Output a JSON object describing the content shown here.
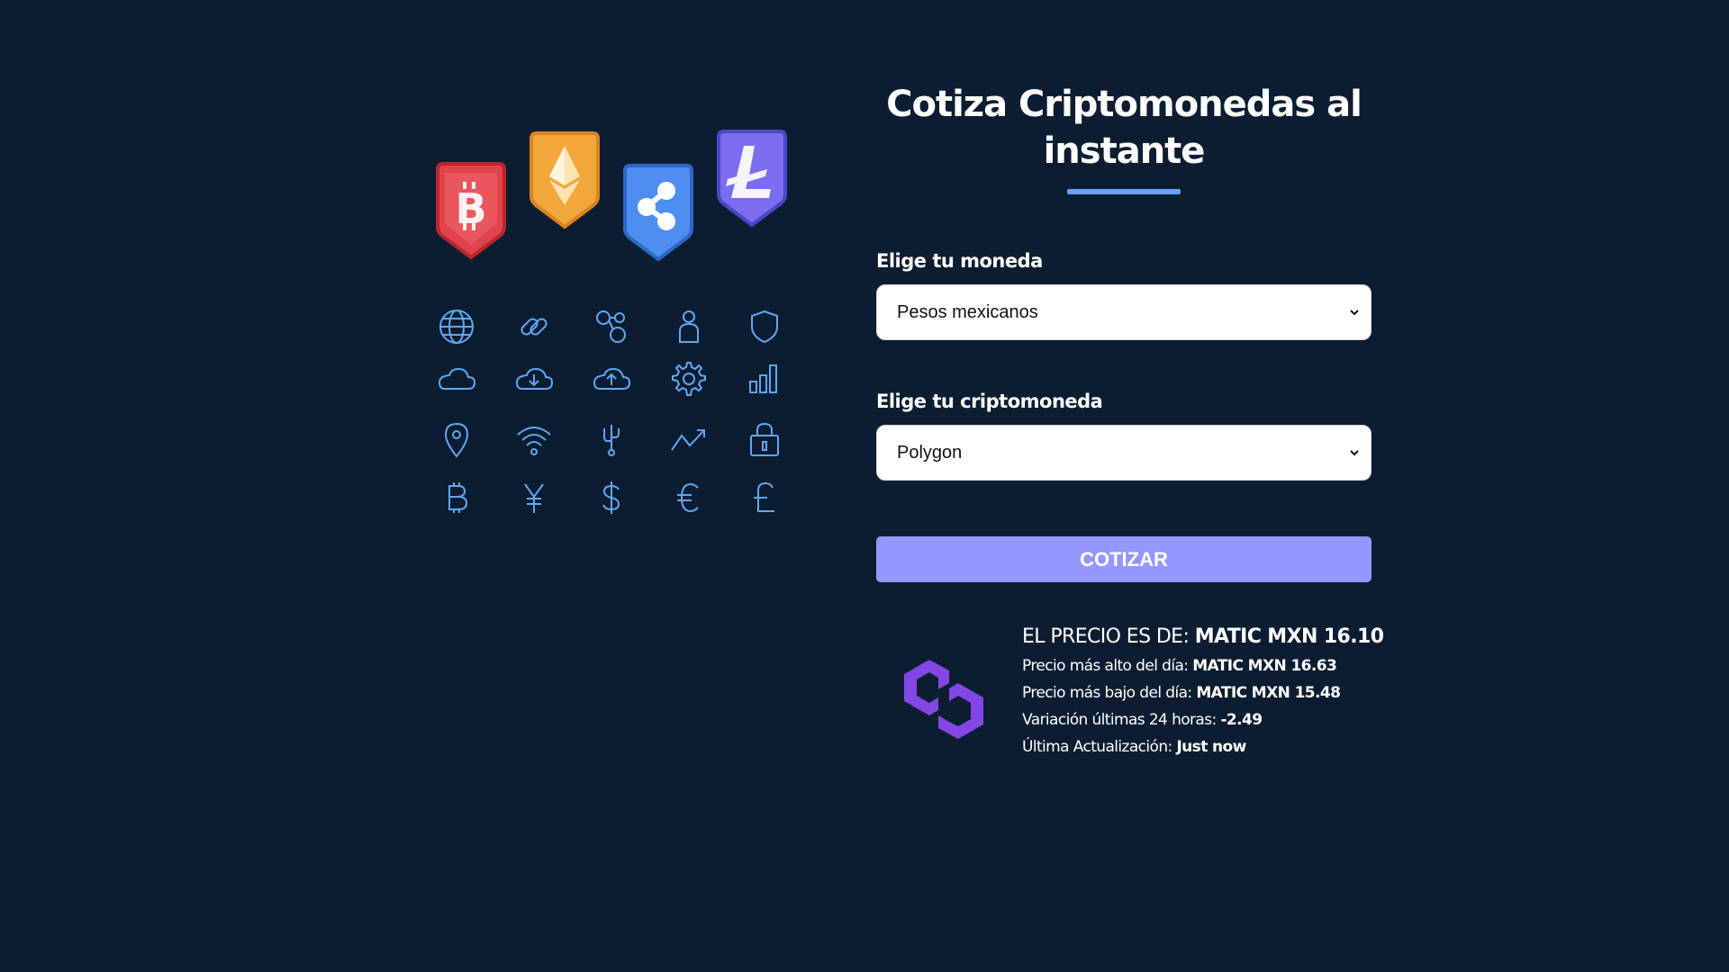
{
  "header": {
    "title": "Cotiza Criptomonedas al instante"
  },
  "form": {
    "currency": {
      "label": "Elige tu moneda",
      "selected": "Pesos mexicanos"
    },
    "crypto": {
      "label": "Elige tu criptomoneda",
      "selected": "Polygon"
    },
    "submit_label": "COTIZAR"
  },
  "result": {
    "price_label": "EL PRECIO ES DE:",
    "price_value": "MATIC MXN 16.10",
    "high_label": "Precio más alto del día:",
    "high_value": "MATIC MXN 16.63",
    "low_label": "Precio más bajo del día:",
    "low_value": "MATIC MXN 15.48",
    "change_label": "Variación últimas 24 horas:",
    "change_value": "-2.49",
    "updated_label": "Última Actualización:",
    "updated_value": "Just now",
    "coin_icon": "polygon-logo-icon"
  },
  "illustration": {
    "badges": [
      "bitcoin-badge-icon",
      "ethereum-badge-icon",
      "ripple-badge-icon",
      "litecoin-badge-icon"
    ],
    "icons": [
      "globe-icon",
      "link-icon",
      "network-icon",
      "user-icon",
      "shield-icon",
      "cloud-icon",
      "cloud-download-icon",
      "cloud-upload-icon",
      "gear-icon",
      "bar-chart-icon",
      "location-pin-icon",
      "wifi-icon",
      "usb-icon",
      "trend-up-icon",
      "lock-icon",
      "bitcoin-icon",
      "yen-icon",
      "dollar-icon",
      "euro-icon",
      "pound-icon"
    ]
  },
  "colors": {
    "background": "#0d1d31",
    "accent": "#66a2fe",
    "button": "#9497ff",
    "polygon": "#8247e5",
    "icon_line": "#5fa8f5"
  }
}
